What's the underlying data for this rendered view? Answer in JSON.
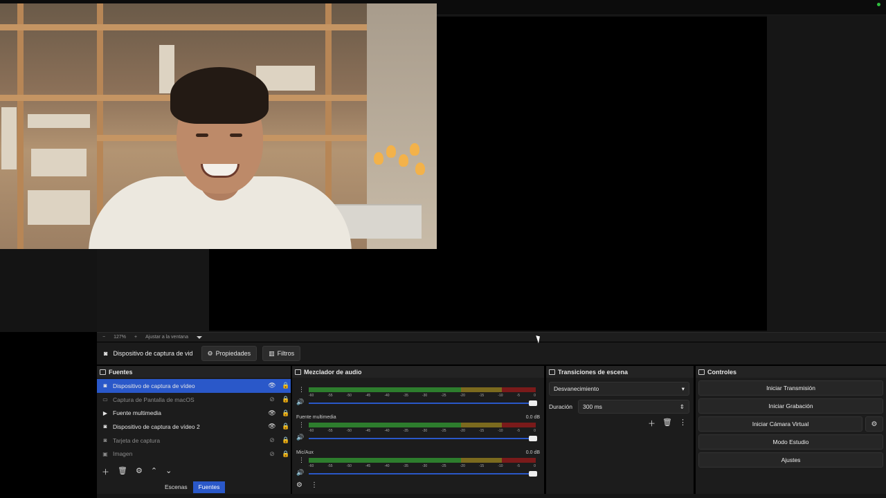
{
  "zoom": {
    "minus": "−",
    "value": "127%",
    "plus": "+",
    "fit_label": "Ajustar a la ventana"
  },
  "context": {
    "source_name": "Dispositivo de captura de vid",
    "properties_label": "Propiedades",
    "filters_label": "Filtros"
  },
  "sources": {
    "title": "Fuentes",
    "items": [
      {
        "label": "Dispositivo de captura de vídeo",
        "icon": "camera-icon",
        "visible": true,
        "selected": true
      },
      {
        "label": "Captura de Pantalla de macOS",
        "icon": "screen-icon",
        "visible": false,
        "selected": false
      },
      {
        "label": "Fuente multimedia",
        "icon": "play-icon",
        "visible": true,
        "selected": false
      },
      {
        "label": "Dispositivo de captura de vídeo 2",
        "icon": "camera-icon",
        "visible": true,
        "selected": false
      },
      {
        "label": "Tarjeta de captura",
        "icon": "camera-icon",
        "visible": false,
        "selected": false
      },
      {
        "label": "Imagen",
        "icon": "image-icon",
        "visible": false,
        "selected": false
      }
    ],
    "tabs": [
      "Escenas",
      "Fuentes"
    ],
    "active_tab": "Fuentes"
  },
  "mixer": {
    "title": "Mezclador de audio",
    "ticks": [
      "-60",
      "-55",
      "-50",
      "-45",
      "-40",
      "-35",
      "-30",
      "-25",
      "-20",
      "-15",
      "-10",
      "-5",
      "0"
    ],
    "channels": [
      {
        "name": "",
        "db": ""
      },
      {
        "name": "Fuente multimedia",
        "db": "0.0 dB"
      },
      {
        "name": "Mic/Aux",
        "db": "0.0 dB"
      }
    ]
  },
  "transitions": {
    "title": "Transiciones de escena",
    "selected": "Desvanecimiento",
    "duration_label": "Duración",
    "duration_value": "300 ms"
  },
  "controls": {
    "title": "Controles",
    "start_stream": "Iniciar Transmisión",
    "start_recording": "Iniciar Grabación",
    "start_virtual_cam": "Iniciar Cámara Virtual",
    "studio_mode": "Modo Estudio",
    "settings": "Ajustes"
  },
  "colors": {
    "accent": "#2a58c9",
    "status": "#2fbf3f"
  }
}
